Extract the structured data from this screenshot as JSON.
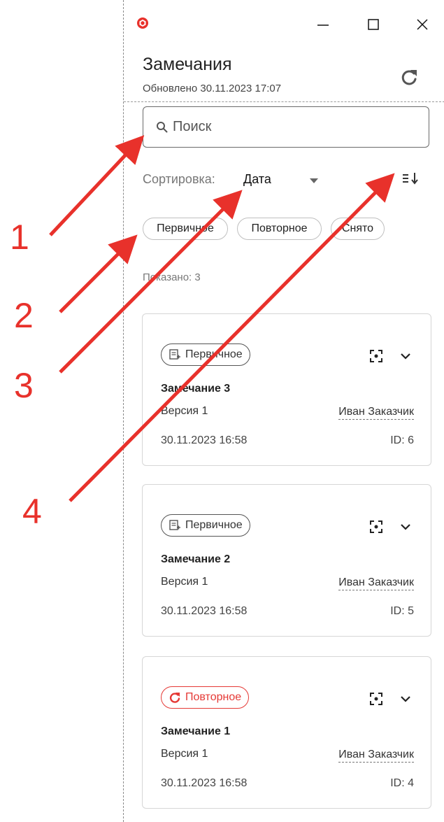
{
  "header": {
    "title": "Замечания",
    "updated": "Обновлено 30.11.2023 17:07"
  },
  "search": {
    "placeholder": "Поиск"
  },
  "sort": {
    "label": "Сортировка:",
    "value": "Дата"
  },
  "filters": [
    "Первичное",
    "Повторное",
    "Снято"
  ],
  "shown": "Показано: 3",
  "cards": [
    {
      "status": "Первичное",
      "status_color": "#555555",
      "title": "Замечание 3",
      "version": "Версия 1",
      "author": "Иван Заказчик",
      "date": "30.11.2023 16:58",
      "id": "ID: 6"
    },
    {
      "status": "Первичное",
      "status_color": "#555555",
      "title": "Замечание 2",
      "version": "Версия 1",
      "author": "Иван Заказчик",
      "date": "30.11.2023 16:58",
      "id": "ID: 5"
    },
    {
      "status": "Повторное",
      "status_color": "#e53935",
      "title": "Замечание 1",
      "version": "Версия 1",
      "author": "Иван Заказчик",
      "date": "30.11.2023 16:58",
      "id": "ID: 4"
    }
  ],
  "callouts": [
    "1",
    "2",
    "3",
    "4"
  ],
  "accent_color": "#e8312b"
}
